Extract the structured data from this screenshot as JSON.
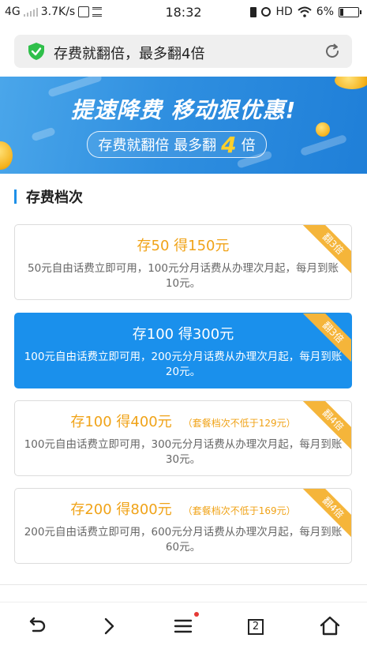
{
  "status_bar": {
    "network": "4G",
    "speed": "3.7K/s",
    "time": "18:32",
    "hd": "HD",
    "battery": "6%"
  },
  "address_bar": {
    "title": "存费就翻倍，最多翻4倍"
  },
  "banner": {
    "headline": "提速降费 移动狠优惠!",
    "pill_prefix": "存费就翻倍  最多翻",
    "pill_number": "4",
    "pill_suffix": "倍"
  },
  "section": {
    "title": "存费档次"
  },
  "plans": [
    {
      "title": "存50 得150元",
      "note": "",
      "description": "50元自由话费立即可用，100元分月话费从办理次月起，每月到账10元。",
      "ribbon": "翻3倍",
      "selected": false
    },
    {
      "title": "存100 得300元",
      "note": "",
      "description": "100元自由话费立即可用，200元分月话费从办理次月起，每月到账20元。",
      "ribbon": "翻3倍",
      "selected": true
    },
    {
      "title": "存100 得400元",
      "note": "（套餐档次不低于129元）",
      "description": "100元自由话费立即可用，300元分月话费从办理次月起，每月到账30元。",
      "ribbon": "翻4倍",
      "selected": false
    },
    {
      "title": "存200 得800元",
      "note": "（套餐档次不低于169元）",
      "description": "200元自由话费立即可用，600元分月话费从办理次月起，每月到账60元。",
      "ribbon": "翻4倍",
      "selected": false
    }
  ],
  "bottom_nav": {
    "tab_count": "2",
    "icons": [
      "back-arrow-icon",
      "forward-chevron-icon",
      "menu-icon",
      "tabs-icon",
      "home-icon"
    ]
  },
  "colors": {
    "accent_blue": "#1a90ec",
    "gold": "#f0a318",
    "ribbon": "#f5b53a",
    "shield_green": "#2fbf4a"
  }
}
